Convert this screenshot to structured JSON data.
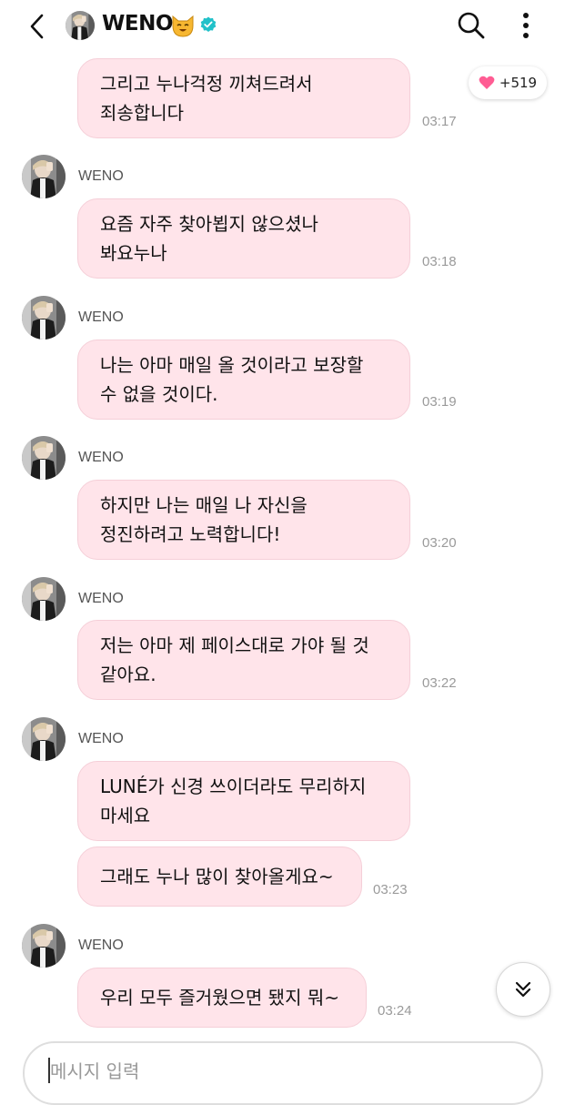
{
  "header": {
    "title": "WENO",
    "icons": [
      "back-arrow-icon",
      "cat-face-emoji-icon",
      "verified-badge-icon",
      "search-icon",
      "more-vertical-icon"
    ]
  },
  "likes": {
    "label": "+519",
    "icon": "heart-icon"
  },
  "messages": [
    {
      "sender": "",
      "lines": [
        "그리고 누나걱정 끼쳐드려서",
        "죄송합니다"
      ],
      "time": "03:17"
    },
    {
      "sender": "WENO",
      "lines": [
        "요즘 자주 찾아뵙지 않으셨나",
        "봐요누나"
      ],
      "time": "03:18"
    },
    {
      "sender": "WENO",
      "lines": [
        "나는 아마 매일 올 것이라고 보장할",
        "수 없을 것이다."
      ],
      "time": "03:19"
    },
    {
      "sender": "WENO",
      "lines": [
        "하지만 나는 매일 나 자신을",
        "정진하려고 노력합니다!"
      ],
      "time": "03:20"
    },
    {
      "sender": "WENO",
      "lines": [
        "저는 아마 제 페이스대로 가야 될 것",
        "같아요."
      ],
      "time": "03:22"
    },
    {
      "sender": "WENO",
      "lines": [
        "LUNÉ가 신경 쓰이더라도 무리하지",
        "마세요"
      ],
      "time": ""
    },
    {
      "sender": "",
      "lines": [
        "그래도 누나 많이 찾아올게요~"
      ],
      "time": "03:23"
    },
    {
      "sender": "WENO",
      "lines": [
        "우리 모두 즐거웠으면 됐지 뭐~"
      ],
      "time": "03:24"
    }
  ],
  "composer": {
    "placeholder": "메시지 입력",
    "value": ""
  },
  "colors": {
    "bubble": "#ffe4ea",
    "bubble_border": "#f5cfd8",
    "verified": "#21c1c9",
    "heart": "#ff5c93"
  }
}
